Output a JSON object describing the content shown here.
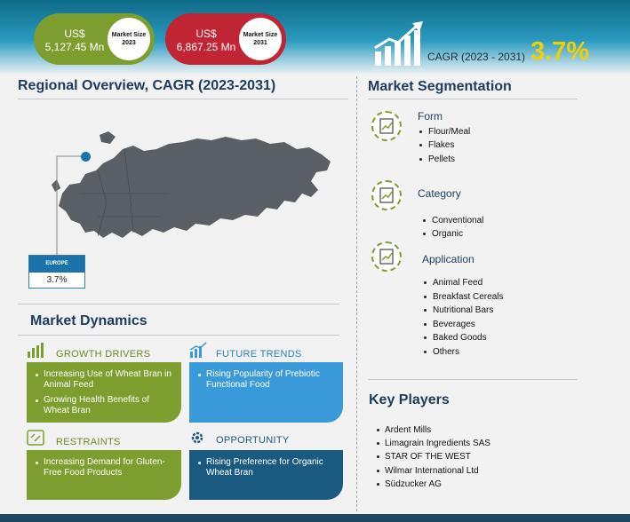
{
  "header": {
    "size_2023": {
      "value": "US$ 5,127.45 Mn",
      "label": "Market Size 2023"
    },
    "size_2031": {
      "value": "US$ 6,867.25 Mn",
      "label": "Market Size 2031"
    },
    "cagr_label": "CAGR (2023 - 2031)",
    "cagr_value": "3.7%",
    "icon": "growth-chart-icon"
  },
  "regional": {
    "title": "Regional Overview, CAGR (2023-2031)",
    "region_name": "EUROPE",
    "region_cagr": "3.7%"
  },
  "dynamics": {
    "title": "Market Dynamics",
    "growth_drivers": {
      "title": "GROWTH DRIVERS",
      "items": [
        "Increasing Use of Wheat Bran in Animal Feed",
        "Growing Health Benefits of Wheat Bran"
      ]
    },
    "future_trends": {
      "title": "FUTURE TRENDS",
      "items": [
        "Rising Popularity of Prebiotic Functional Food"
      ]
    },
    "restraints": {
      "title": "RESTRAINTS",
      "items": [
        "Increasing Demand for Gluten-Free Food Products"
      ]
    },
    "opportunity": {
      "title": "OPPORTUNITY",
      "items": [
        "Rising Preference for Organic Wheat Bran"
      ]
    }
  },
  "segmentation": {
    "title": "Market Segmentation",
    "groups": [
      {
        "label": "Form",
        "items": [
          "Flour/Meal",
          "Flakes",
          "Pellets"
        ]
      },
      {
        "label": "Category",
        "items": [
          "Conventional",
          "Organic"
        ]
      },
      {
        "label": "Application",
        "items": [
          "Animal Feed",
          "Breakfast Cereals",
          "Nutritional Bars",
          "Beverages",
          "Baked Goods",
          "Others"
        ]
      }
    ]
  },
  "key_players": {
    "title": "Key Players",
    "items": [
      "Ardent Mills",
      "Limagrain Ingredients SAS",
      "STAR OF THE WEST",
      "Wilmar International Ltd",
      "Südzucker AG"
    ]
  },
  "colors": {
    "green": "#7d9e2e",
    "red": "#c12432",
    "blue": "#3a9ad9",
    "navy": "#1b5a80",
    "accent": "#f0d000"
  }
}
